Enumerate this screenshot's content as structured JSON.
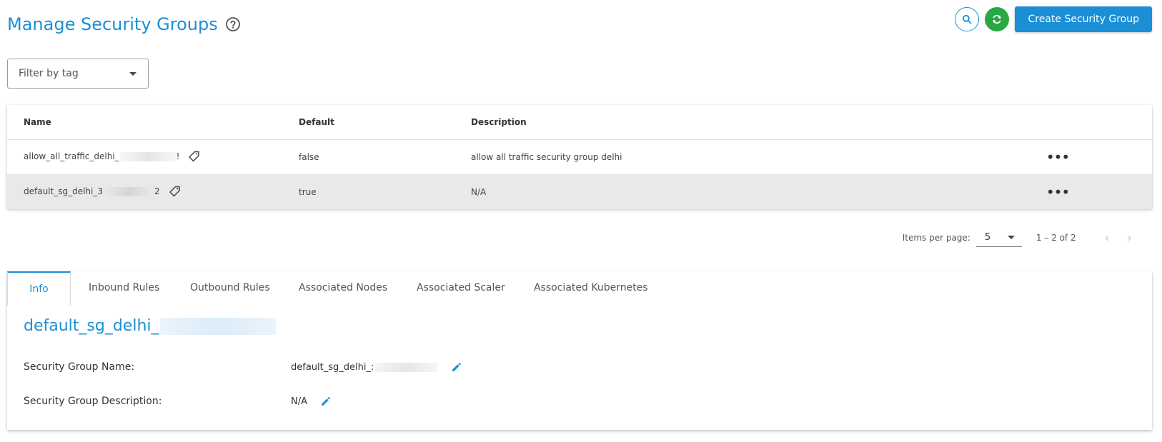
{
  "page": {
    "title": "Manage Security Groups"
  },
  "toolbar": {
    "search_icon": "search-icon",
    "refresh_icon": "refresh-icon",
    "create_label": "Create Security Group"
  },
  "filter": {
    "placeholder": "Filter by tag"
  },
  "table": {
    "columns": [
      "Name",
      "Default",
      "Description"
    ],
    "rows": [
      {
        "name": "allow_all_traffic_delhi_",
        "name_suffix": "!",
        "default": "false",
        "description": "allow all traffic security group delhi",
        "selected": false
      },
      {
        "name": "default_sg_delhi_3",
        "name_suffix": "2",
        "default": "true",
        "description": "N/A",
        "selected": true
      }
    ]
  },
  "pagination": {
    "items_per_page_label": "Items per page:",
    "items_per_page_value": "5",
    "range_label": "1 – 2 of 2"
  },
  "detail": {
    "tabs": [
      "Info",
      "Inbound Rules",
      "Outbound Rules",
      "Associated Nodes",
      "Associated Scaler",
      "Associated Kubernetes"
    ],
    "active_tab": "Info",
    "title": "default_sg_delhi_",
    "name_label": "Security Group Name:",
    "name_value": "default_sg_delhi_:",
    "description_label": "Security Group Description:",
    "description_value": "N/A"
  },
  "colors": {
    "accent": "#1a8fd6",
    "refresh": "#28a745",
    "selected_row": "#e9e9e9"
  }
}
